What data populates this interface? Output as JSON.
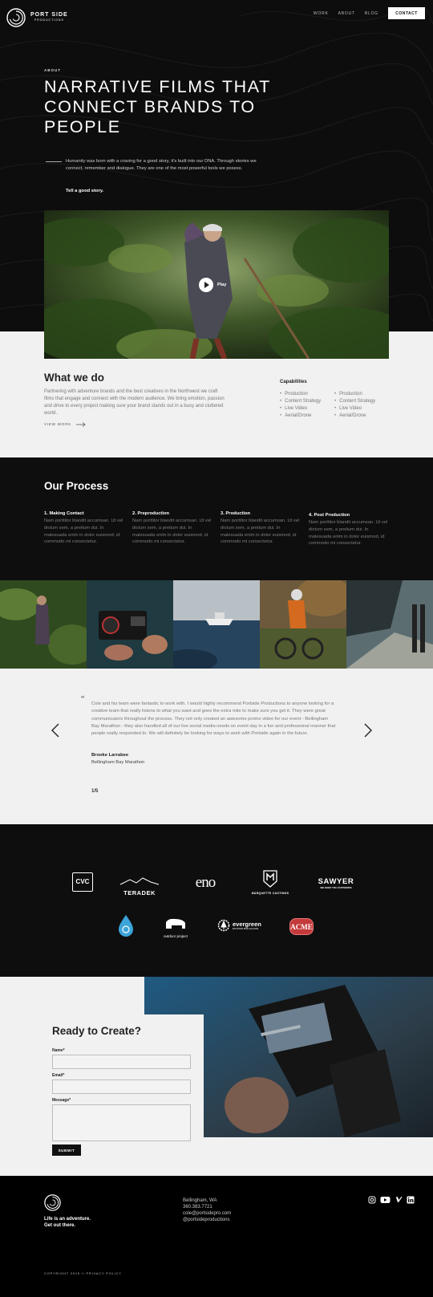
{
  "header": {
    "brand": "PORT SIDE",
    "brand_sub": "PRODUCTIONS",
    "nav": [
      "WORK",
      "ABOUT",
      "BLOG"
    ],
    "contact": "CONTACT"
  },
  "hero": {
    "label": "ABOUT",
    "title": "NARRATIVE FILMS THAT CONNECT BRANDS TO PEOPLE",
    "text": "Humanity was born with a craving for a good story, it's built into our DNA. Through stories we connect, remember and dialogue. They are one of the most powerful tools we posess.",
    "cta": "Tell a good story.",
    "play": "Play"
  },
  "what": {
    "title": "What we do",
    "text": "Partnering with adventure brands and the best creatives in the Northwest we craft films that engage and connect with the modern audience. We bring emotion, passion and drive to every project making sure your brand stands out in a busy and cluttered world.",
    "link": "VIEW WORK",
    "cap_title": "Capabilities",
    "cap_col1": [
      "Production",
      "Content Strategy",
      "Live Video",
      "Aerial/Drone"
    ],
    "cap_col2": [
      "Production",
      "Content Strategy",
      "Live Video",
      "Aerial/Drone"
    ]
  },
  "process": {
    "title": "Our Process",
    "steps": [
      {
        "title": "1. Making Contact",
        "text": "Nam porttitor blandit accumsan. Ut vel dictum sem, a pretium dui. In malesuada enim in dolor euismod, id commodo mi consectetur."
      },
      {
        "title": "2. Preproduction",
        "text": "Nam porttitor blandit accumsan. Ut vel dictum sem, a pretium dui. In malesuada enim in dolor euismod, id commodo mi consectetur."
      },
      {
        "title": "3. Production",
        "text": "Nam porttitor blandit accumsan. Ut vel dictum sem, a pretium dui. In malesuada enim in dolor euismod, id commodo mi consectetur."
      },
      {
        "title": "4. Post Production",
        "text": "Nam porttitor blandit accumsan. Ut vel dictum sem, a pretium dui. In malesuada enim in dolor euismod, id commodo mi consectetur."
      }
    ]
  },
  "testimonial": {
    "quote": "Cole and his team were fantastic to work with. I would highly recommend Portside Productions to anyone looking for a creative team that really listens to what you want and goes the extra mile to make sure you get it. They were great communicators throughout the process. They not only created an awesome promo video for our event - Bellingham Bay Marathon - they also handled all of our live social media needs on event day in a fun and professional manner that people really responded to. We will definitely be looking for ways to work with Portside again in the future.",
    "author": "Brooke Larrabee",
    "org": "Bellingham Bay Marathon",
    "counter": "1/5"
  },
  "clients": {
    "logos": [
      "CVC",
      "TERADEK",
      "eno",
      "MARQUETTE CASTINGS",
      "SAWYER",
      "",
      "outdoor project",
      "evergreen",
      "ACME"
    ],
    "sawyer_sub": "WE KEEP YOU OUTDOORS",
    "evergreen_sub": "MOUNTAIN BIKE ALLIANCE"
  },
  "contact_form": {
    "title": "Ready to Create?",
    "name_label": "Name*",
    "email_label": "Email*",
    "message_label": "Message*",
    "submit": "SUBMIT"
  },
  "footer": {
    "tagline_1": "Life is an adventure.",
    "tagline_2": "Get out there.",
    "contact": [
      "Bellingham, WA",
      "360.383.7721",
      "cole@portsidepro.com",
      "@portsideproductions"
    ],
    "copyright": "COPYRIGHT 2019 // PRIVACY POLICY"
  },
  "colors": {
    "dark": "#0e0e0f",
    "light": "#f1f1f1",
    "white": "#ffffff"
  }
}
